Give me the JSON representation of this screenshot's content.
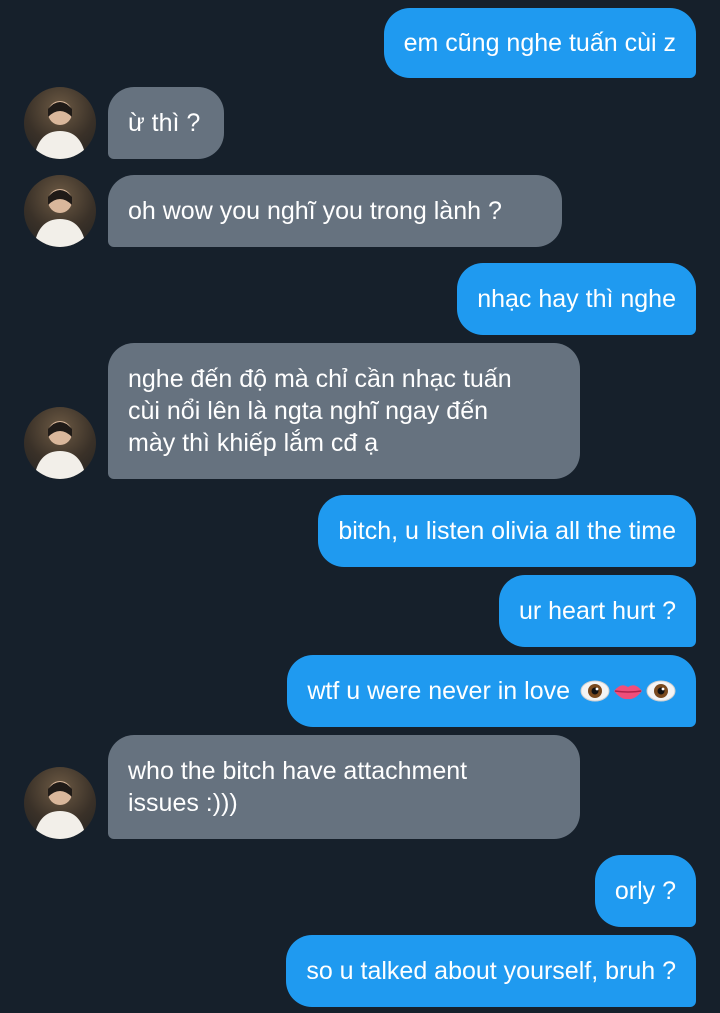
{
  "conversation": {
    "messages": [
      {
        "id": "m1",
        "direction": "outgoing",
        "text": "em cũng nghe tuấn cùi z"
      },
      {
        "id": "m2",
        "direction": "incoming",
        "text": "ừ thì ?"
      },
      {
        "id": "m3",
        "direction": "incoming",
        "text": "oh wow you nghĩ you trong lành ?"
      },
      {
        "id": "m4",
        "direction": "outgoing",
        "text": "nhạc hay thì nghe"
      },
      {
        "id": "m5",
        "direction": "incoming",
        "lines": [
          "nghe đến độ mà chỉ cần nhạc tuấn",
          "cùi nổi lên là ngta nghĩ ngay đến",
          "mày thì khiếp lắm cđ ạ"
        ]
      },
      {
        "id": "m6",
        "direction": "outgoing",
        "text": "bitch, u listen olivia all the time"
      },
      {
        "id": "m7",
        "direction": "outgoing",
        "text": "ur heart hurt ?"
      },
      {
        "id": "m8",
        "direction": "outgoing",
        "text": "wtf u were never in love",
        "emoji": [
          "eye",
          "lips",
          "eye"
        ]
      },
      {
        "id": "m9",
        "direction": "incoming",
        "lines": [
          "who the bitch have attachment",
          "issues :)))"
        ]
      },
      {
        "id": "m10",
        "direction": "outgoing",
        "text": "orly ?"
      },
      {
        "id": "m11",
        "direction": "outgoing",
        "text": "so u talked about yourself, bruh ?"
      }
    ]
  },
  "theme": {
    "background": "#16202b",
    "outgoing_bubble": "#1f9af0",
    "incoming_bubble": "#66727f",
    "text": "#ffffff"
  },
  "icons": {
    "avatar": "contact-avatar-photo",
    "emoji_eye": "eye-emoji",
    "emoji_lips": "lips-emoji"
  }
}
